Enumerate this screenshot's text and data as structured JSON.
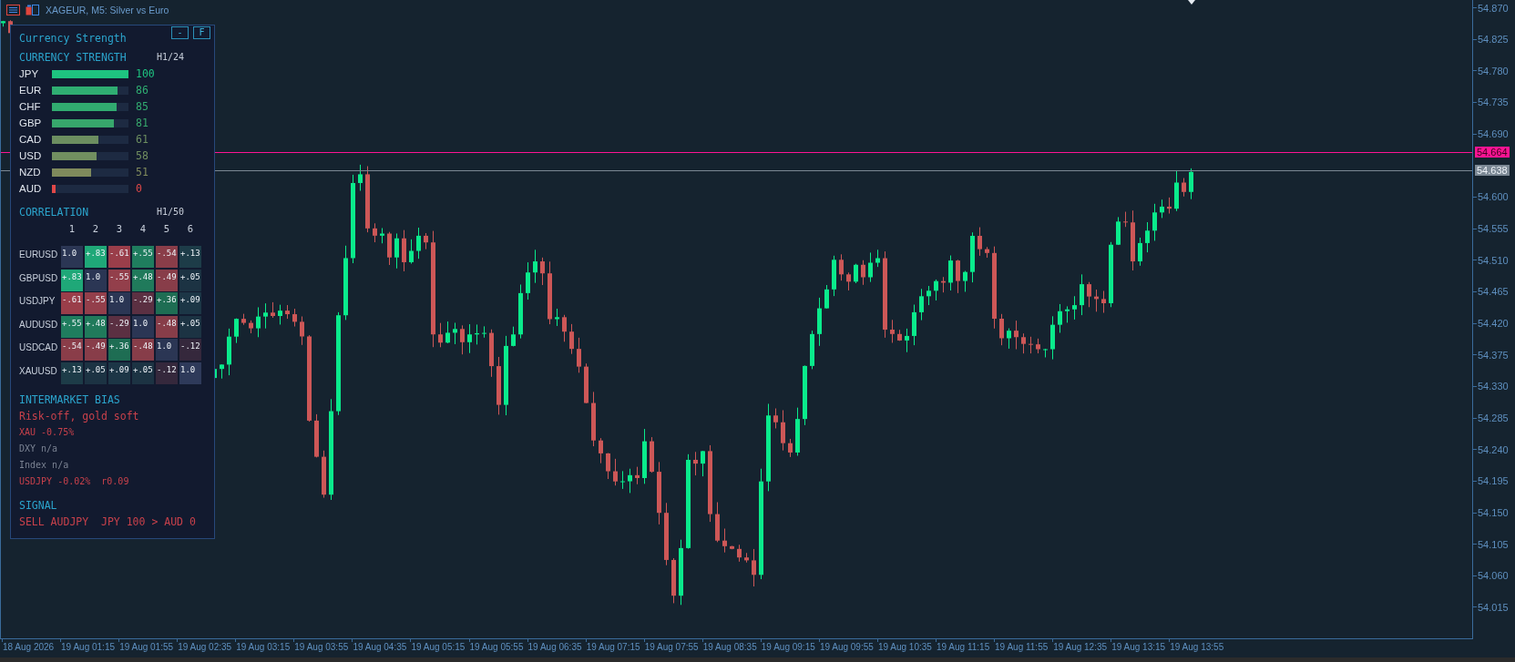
{
  "chart_header": {
    "title": "XAGEUR, M5: Silver vs Euro"
  },
  "panel": {
    "title": "Currency Strength",
    "buttons": [
      {
        "label": "-"
      },
      {
        "label": "F"
      }
    ]
  },
  "currency_strength": {
    "heading": "CURRENCY STRENGTH",
    "timeframe": "H1/24",
    "rows": [
      {
        "currency": "JPY",
        "value": "100",
        "level": 1.0,
        "color": "#1ec480"
      },
      {
        "currency": "EUR",
        "value": "86",
        "level": 0.86,
        "color": "#2fae72"
      },
      {
        "currency": "CHF",
        "value": "85",
        "level": 0.85,
        "color": "#31ab70"
      },
      {
        "currency": "GBP",
        "value": "81",
        "level": 0.81,
        "color": "#37a76c"
      },
      {
        "currency": "CAD",
        "value": "61",
        "level": 0.61,
        "color": "#6c8e60"
      },
      {
        "currency": "USD",
        "value": "58",
        "level": 0.58,
        "color": "#718f60"
      },
      {
        "currency": "NZD",
        "value": "51",
        "level": 0.51,
        "color": "#7f8a5c"
      },
      {
        "currency": "AUD",
        "value": "0",
        "level": 0.05,
        "color": "#e04848"
      }
    ]
  },
  "correlation": {
    "heading": "CORRELATION",
    "timeframe": "H1/50",
    "columns": [
      "1",
      "2",
      "3",
      "4",
      "5",
      "6"
    ],
    "rows": [
      {
        "symbol": "EURUSD",
        "cells": [
          {
            "text": "1.0",
            "color": "#2b3654"
          },
          {
            "text": "+.83",
            "color": "#1fa878"
          },
          {
            "text": "-.61",
            "color": "#9a3e4a"
          },
          {
            "text": "+.55",
            "color": "#1f7d5e"
          },
          {
            "text": "-.54",
            "color": "#8a3d49"
          },
          {
            "text": "+.13",
            "color": "#1d3c48"
          }
        ]
      },
      {
        "symbol": "GBPUSD",
        "cells": [
          {
            "text": "+.83",
            "color": "#1fa878"
          },
          {
            "text": "1.0",
            "color": "#2b3654"
          },
          {
            "text": "-.55",
            "color": "#933f4b"
          },
          {
            "text": "+.48",
            "color": "#207a5b"
          },
          {
            "text": "-.49",
            "color": "#883d49"
          },
          {
            "text": "+.05",
            "color": "#1c3343"
          }
        ]
      },
      {
        "symbol": "USDJPY",
        "cells": [
          {
            "text": "-.61",
            "color": "#9a3e4a"
          },
          {
            "text": "-.55",
            "color": "#933f4b"
          },
          {
            "text": "1.0",
            "color": "#2b3654"
          },
          {
            "text": "-.29",
            "color": "#5b3042"
          },
          {
            "text": "+.36",
            "color": "#1e6d53"
          },
          {
            "text": "+.09",
            "color": "#1c3646"
          }
        ]
      },
      {
        "symbol": "AUDUSD",
        "cells": [
          {
            "text": "+.55",
            "color": "#1f7d5e"
          },
          {
            "text": "+.48",
            "color": "#207a5b"
          },
          {
            "text": "-.29",
            "color": "#5b3042"
          },
          {
            "text": "1.0",
            "color": "#2b3654"
          },
          {
            "text": "-.48",
            "color": "#873d49"
          },
          {
            "text": "+.05",
            "color": "#1c3343"
          }
        ]
      },
      {
        "symbol": "USDCAD",
        "cells": [
          {
            "text": "-.54",
            "color": "#8a3d49"
          },
          {
            "text": "-.49",
            "color": "#883d49"
          },
          {
            "text": "+.36",
            "color": "#1e6d53"
          },
          {
            "text": "-.48",
            "color": "#873d49"
          },
          {
            "text": "1.0",
            "color": "#2b3654"
          },
          {
            "text": "-.12",
            "color": "#35283c"
          }
        ]
      },
      {
        "symbol": "XAUUSD",
        "cells": [
          {
            "text": "+.13",
            "color": "#1d3c48"
          },
          {
            "text": "+.05",
            "color": "#1c3343"
          },
          {
            "text": "+.09",
            "color": "#1c3646"
          },
          {
            "text": "+.05",
            "color": "#1c3343"
          },
          {
            "text": "-.12",
            "color": "#35283c"
          },
          {
            "text": "1.0",
            "color": "#2e3a5a"
          }
        ]
      }
    ]
  },
  "intermarket_bias": {
    "heading": "INTERMARKET BIAS",
    "lines": [
      {
        "text": "Risk-off, gold soft",
        "kind": "summary",
        "color": "#c8414b"
      },
      {
        "text": "XAU -0.75%",
        "kind": "detail",
        "color": "#c8414b"
      },
      {
        "text": "DXY n/a",
        "kind": "detail",
        "color": "#7a8292"
      },
      {
        "text": "Index n/a",
        "kind": "detail",
        "color": "#7a8292"
      },
      {
        "text": "USDJPY -0.02%  r0.09",
        "kind": "detail",
        "color": "#c8414b"
      }
    ]
  },
  "signal": {
    "heading": "SIGNAL",
    "text": "SELL AUDJPY  JPY 100 > AUD 0"
  },
  "price_axis": {
    "labels": [
      "54.870",
      "54.825",
      "54.780",
      "54.735",
      "54.690",
      "54.600",
      "54.555",
      "54.510",
      "54.465",
      "54.420",
      "54.375",
      "54.330",
      "54.285",
      "54.240",
      "54.195",
      "54.150",
      "54.105",
      "54.060",
      "54.015"
    ],
    "markers": [
      {
        "label": "54.664",
        "color": "#ff1493"
      },
      {
        "label": "54.638",
        "color": "#7b8894"
      }
    ]
  },
  "time_axis": {
    "labels": [
      "18 Aug 2026",
      "19 Aug 01:15",
      "19 Aug 01:55",
      "19 Aug 02:35",
      "19 Aug 03:15",
      "19 Aug 03:55",
      "19 Aug 04:35",
      "19 Aug 05:15",
      "19 Aug 05:55",
      "19 Aug 06:35",
      "19 Aug 07:15",
      "19 Aug 07:55",
      "19 Aug 08:35",
      "19 Aug 09:15",
      "19 Aug 09:55",
      "19 Aug 10:35",
      "19 Aug 11:15",
      "19 Aug 11:55",
      "19 Aug 12:35",
      "19 Aug 13:15",
      "19 Aug 13:55"
    ]
  }
}
